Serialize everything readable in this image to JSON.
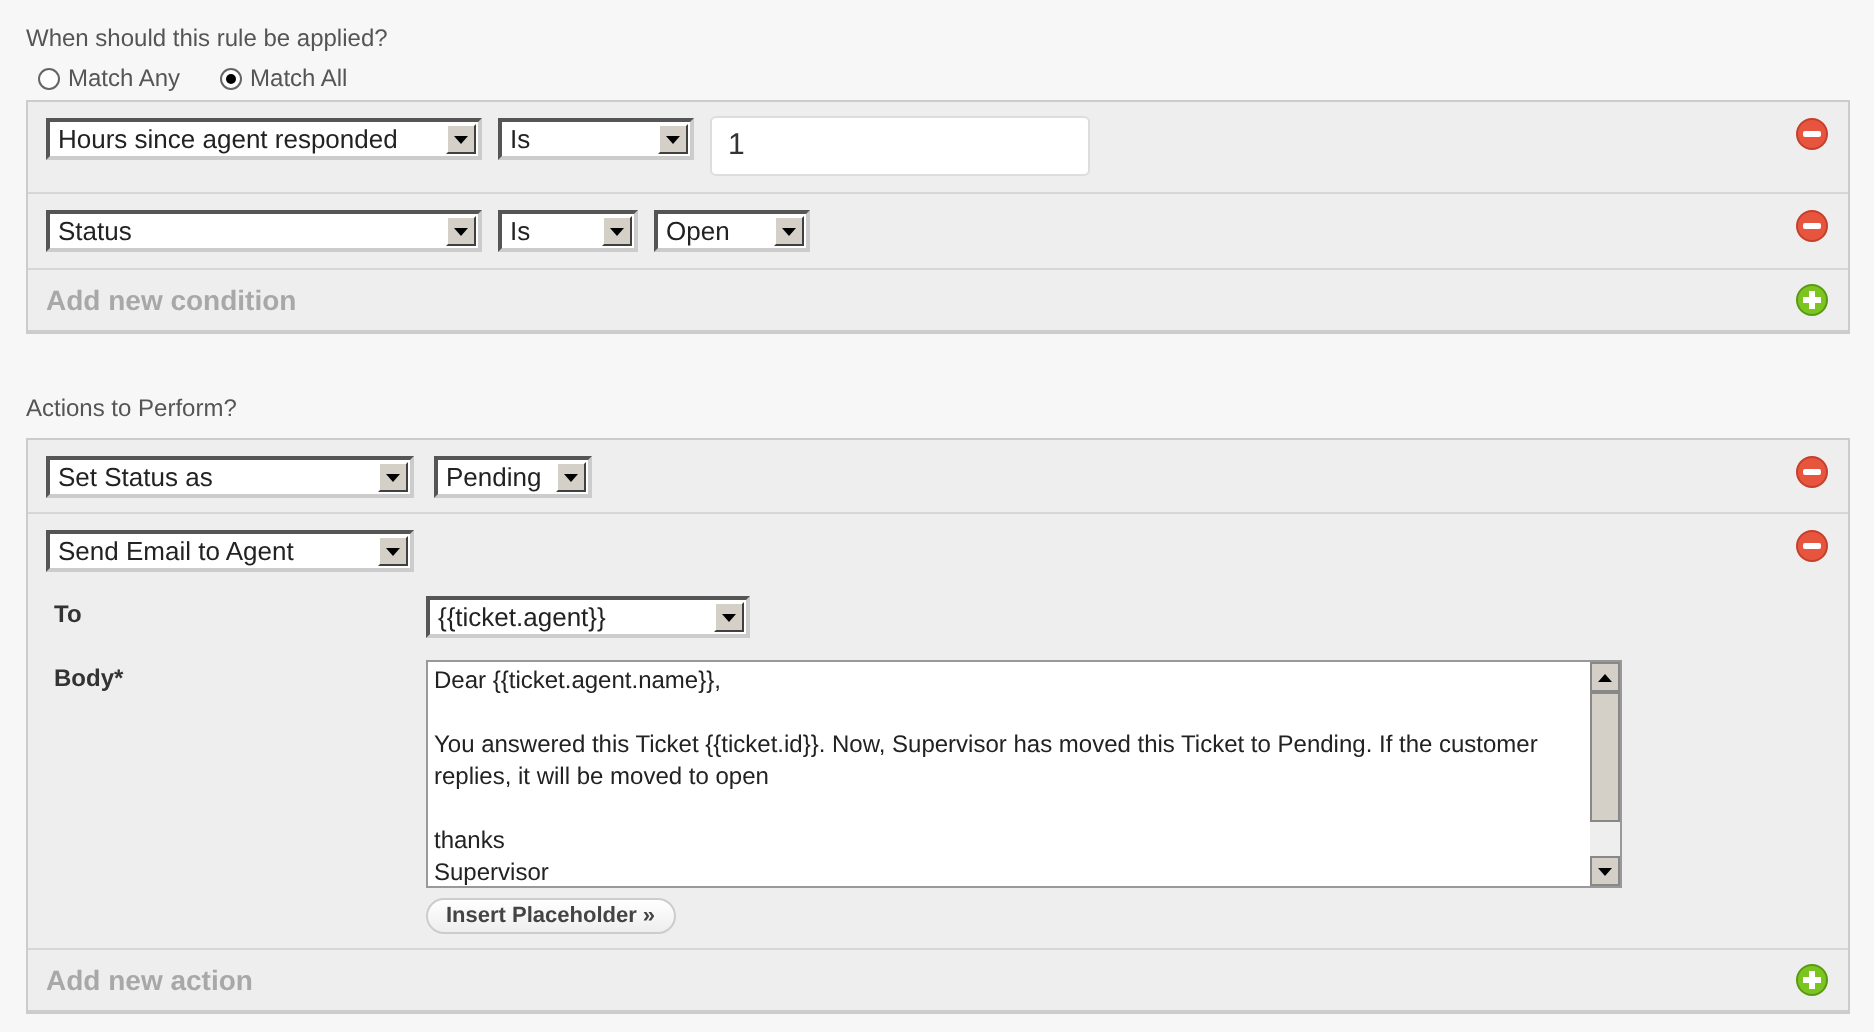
{
  "conditions_heading": "When should this rule be applied?",
  "match": [
    {
      "label": "Match Any",
      "selected": false
    },
    {
      "label": "Match All",
      "selected": true
    }
  ],
  "conditions": [
    {
      "field": "Hours since agent responded",
      "operator": "Is",
      "value": {
        "kind": "text",
        "value": "1"
      }
    },
    {
      "field": "Status",
      "operator": "Is",
      "value": {
        "kind": "select",
        "value": "Open"
      }
    }
  ],
  "add_condition": "Add new condition",
  "actions_heading": "Actions to Perform?",
  "actions": [
    {
      "kind": "status",
      "action": "Set Status as",
      "value": "Pending"
    },
    {
      "kind": "email",
      "action": "Send Email to Agent",
      "to_label": "To",
      "to": "{{ticket.agent}}",
      "body_label": "Body*",
      "body": [
        [
          "Dear {{ticket.agent.name}},"
        ],
        [
          "You answered this Ticket {{ticket.id}}. Now, Supervisor has moved this Ticket to Pending. If the customer replies, it will be moved to open"
        ],
        [
          "thanks",
          "Supervisor"
        ]
      ],
      "insert_button": "Insert Placeholder »"
    }
  ],
  "add_action": "Add new action"
}
